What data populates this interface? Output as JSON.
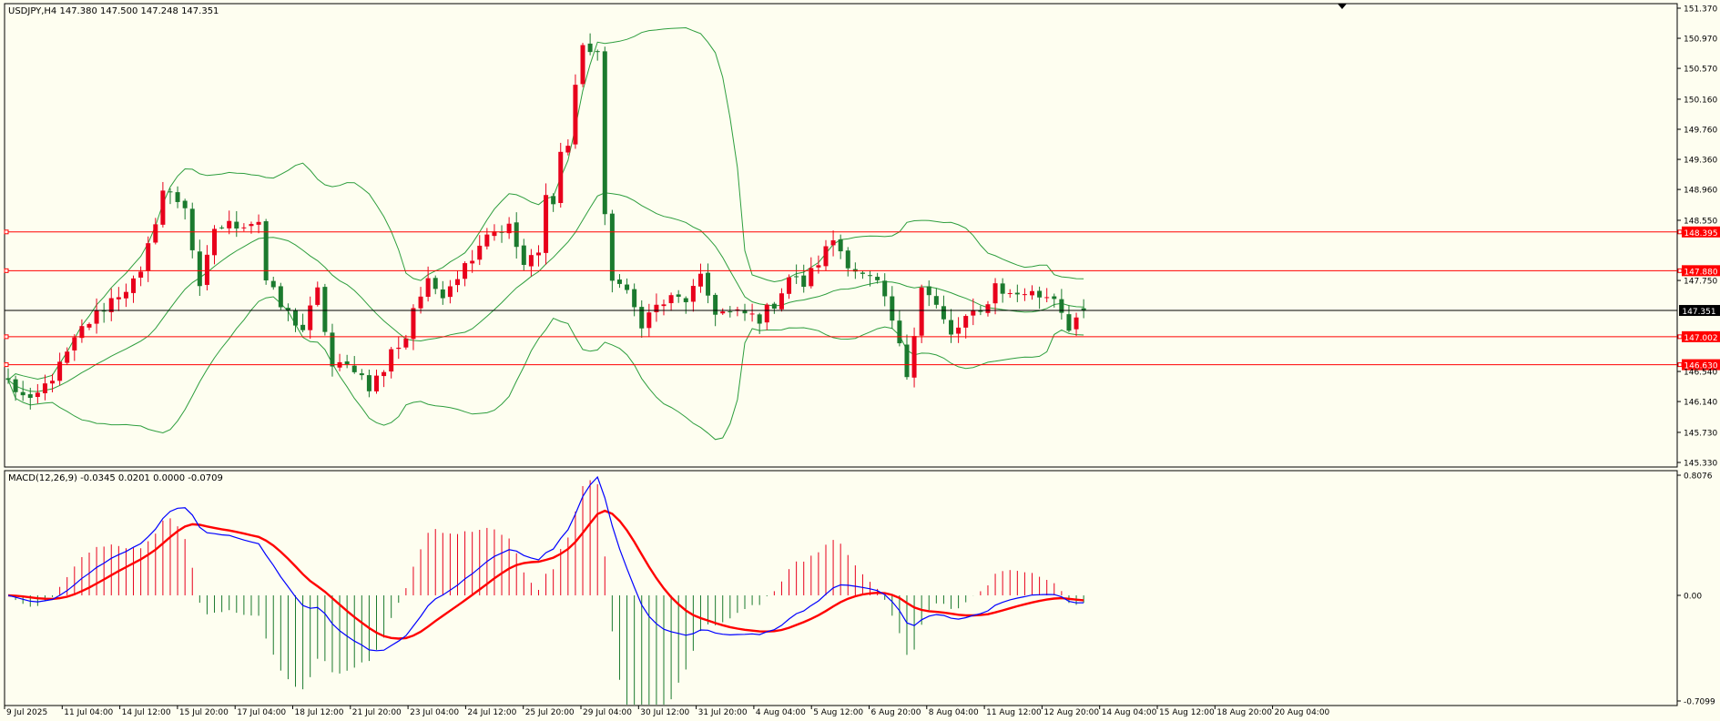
{
  "header": {
    "symbol_line": "USDJPY,H4  147.380 147.500 147.248 147.351",
    "macd_line": "MACD(12,26,9) -0.0345 0.0201 0.0000 -0.0709"
  },
  "colors": {
    "background": "#fefef0",
    "bull_candle": "#e8001c",
    "bear_candle": "#1b7a2e",
    "bollinger": "#2e9e3e",
    "level_line": "#ff0000",
    "current_price_line": "#000000",
    "macd_line": "#0000ff",
    "signal_line": "#ff0000"
  },
  "chart_data": [
    {
      "type": "candlestick",
      "symbol": "USDJPY",
      "timeframe": "H4",
      "ohlc_header": {
        "open": 147.38,
        "high": 147.5,
        "low": 147.248,
        "close": 147.351
      },
      "ylim": [
        145.33,
        151.37
      ],
      "y_ticks": [
        "151.370",
        "150.970",
        "150.570",
        "150.160",
        "149.760",
        "149.360",
        "148.960",
        "148.550",
        "147.750",
        "146.540",
        "146.140",
        "145.730",
        "145.330"
      ],
      "price_levels": [
        {
          "value": 148.395,
          "label": "148.395"
        },
        {
          "value": 147.88,
          "label": "147.880"
        },
        {
          "value": 147.002,
          "label": "147.002"
        },
        {
          "value": 146.63,
          "label": "146.630"
        }
      ],
      "current_price": {
        "value": 147.351,
        "label": "147.351"
      },
      "x_labels": [
        "9 Jul 2025",
        "11 Jul 04:00",
        "14 Jul 12:00",
        "15 Jul 20:00",
        "17 Jul 04:00",
        "18 Jul 12:00",
        "21 Jul 20:00",
        "23 Jul 04:00",
        "24 Jul 12:00",
        "25 Jul 20:00",
        "29 Jul 04:00",
        "30 Jul 12:00",
        "31 Jul 20:00",
        "4 Aug 04:00",
        "5 Aug 12:00",
        "6 Aug 20:00",
        "8 Aug 04:00",
        "11 Aug 12:00",
        "12 Aug 20:00",
        "14 Aug 04:00",
        "15 Aug 12:00",
        "18 Aug 20:00",
        "20 Aug 04:00"
      ],
      "close_path": [
        [
          0,
          146.4
        ],
        [
          3,
          146.1
        ],
        [
          7,
          146.6
        ],
        [
          10,
          147.1
        ],
        [
          14,
          147.5
        ],
        [
          18,
          147.8
        ],
        [
          21,
          148.95
        ],
        [
          24,
          148.75
        ],
        [
          26,
          147.6
        ],
        [
          28,
          148.45
        ],
        [
          31,
          148.5
        ],
        [
          34,
          148.55
        ],
        [
          35,
          147.75
        ],
        [
          37,
          147.4
        ],
        [
          40,
          147.1
        ],
        [
          42,
          147.6
        ],
        [
          44,
          146.6
        ],
        [
          47,
          146.6
        ],
        [
          49,
          146.35
        ],
        [
          51,
          146.55
        ],
        [
          52,
          146.8
        ],
        [
          54,
          147.0
        ],
        [
          55,
          147.4
        ],
        [
          57,
          147.7
        ],
        [
          59,
          147.6
        ],
        [
          62,
          147.95
        ],
        [
          65,
          148.4
        ],
        [
          68,
          148.45
        ],
        [
          70,
          147.95
        ],
        [
          72,
          148.1
        ],
        [
          73,
          148.85
        ],
        [
          74,
          148.85
        ],
        [
          75,
          149.45
        ],
        [
          76,
          149.55
        ],
        [
          77,
          150.35
        ],
        [
          78,
          150.85
        ],
        [
          80,
          150.8
        ],
        [
          81,
          148.55
        ],
        [
          82,
          147.8
        ],
        [
          83,
          147.7
        ],
        [
          84,
          147.55
        ],
        [
          86,
          147.2
        ],
        [
          88,
          147.4
        ],
        [
          90,
          147.5
        ],
        [
          92,
          147.5
        ],
        [
          94,
          147.75
        ],
        [
          96,
          147.35
        ],
        [
          98,
          147.3
        ],
        [
          100,
          147.3
        ],
        [
          102,
          147.25
        ],
        [
          104,
          147.45
        ],
        [
          106,
          147.8
        ],
        [
          108,
          147.7
        ],
        [
          110,
          148.0
        ],
        [
          112,
          148.3
        ],
        [
          114,
          148.0
        ],
        [
          116,
          147.8
        ],
        [
          118,
          147.7
        ],
        [
          120,
          147.2
        ],
        [
          122,
          146.5
        ],
        [
          124,
          147.7
        ],
        [
          126,
          147.4
        ],
        [
          128,
          147.0
        ],
        [
          130,
          147.25
        ],
        [
          132,
          147.3
        ],
        [
          134,
          147.7
        ],
        [
          136,
          147.55
        ],
        [
          138,
          147.6
        ],
        [
          140,
          147.55
        ],
        [
          142,
          147.55
        ],
        [
          144,
          147.15
        ],
        [
          146,
          147.35
        ]
      ]
    },
    {
      "type": "line",
      "title": "MACD(12,26,9)",
      "values": {
        "macd": -0.0345,
        "signal": 0.0201
      },
      "ylim": [
        -0.7099,
        0.8076
      ],
      "y_ticks": [
        "0.8076",
        "0.00",
        "-0.7099"
      ]
    }
  ]
}
